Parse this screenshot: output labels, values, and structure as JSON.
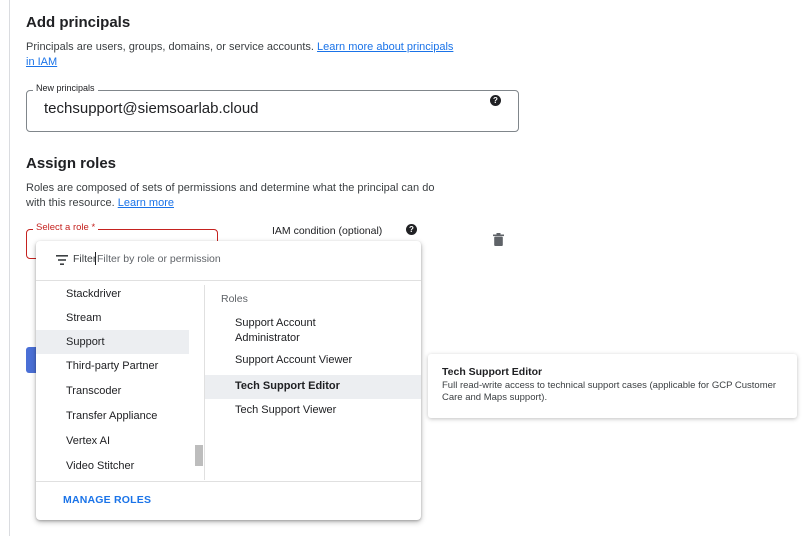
{
  "principals": {
    "heading": "Add principals",
    "description": "Principals are users, groups, domains, or service accounts.",
    "learn_more_line1": "Learn more about principals",
    "learn_more_line2": "in IAM",
    "field_label": "New principals",
    "field_value": "techsupport@siemsoarlab.cloud"
  },
  "roles": {
    "heading": "Assign roles",
    "description_line1": "Roles are composed of sets of permissions and determine what the principal can do",
    "description_line2": "with this resource.",
    "learn_more": "Learn more",
    "select_label": "Select a role *",
    "iam_condition_label": "IAM condition (optional)"
  },
  "dropdown": {
    "filter_label": "Filter",
    "filter_placeholder": "Filter by role or permission",
    "categories": [
      "Stackdriver",
      "Stream",
      "Support",
      "Third-party Partner",
      "Transcoder",
      "Transfer Appliance",
      "Vertex AI",
      "Video Stitcher"
    ],
    "selected_category": "Support",
    "roles_heading": "Roles",
    "role_items": [
      "Support Account Administrator",
      "Support Account Viewer",
      "Tech Support Editor",
      "Tech Support Viewer"
    ],
    "highlighted_role": "Tech Support Editor",
    "manage_roles": "MANAGE ROLES"
  },
  "tooltip": {
    "title": "Tech Support Editor",
    "description": "Full read-write access to technical support cases (applicable for GCP Customer Care and Maps support)."
  },
  "icons": {
    "help": "help-icon",
    "delete": "trash-icon",
    "filter": "filter-icon"
  },
  "colors": {
    "link": "#1a73e8",
    "error": "#c5221f",
    "highlight": "#eceef1"
  }
}
